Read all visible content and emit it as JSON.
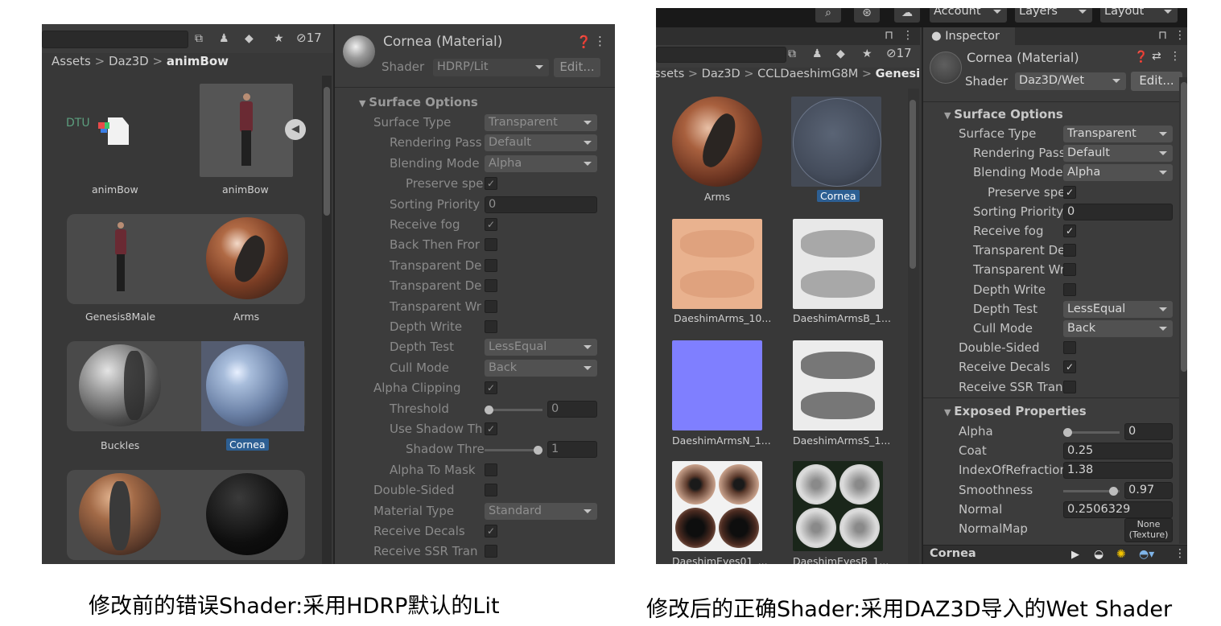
{
  "left": {
    "toolbar": {
      "hidden_count": "17"
    },
    "breadcrumb": {
      "a": "Assets",
      "b": "Daz3D",
      "c": "animBow",
      "sep": ">"
    },
    "assets": [
      {
        "label": "animBow",
        "type": "dtu",
        "badge": "DTU"
      },
      {
        "label": "animBow",
        "type": "figure"
      },
      {
        "label": "Genesis8Male",
        "type": "figure"
      },
      {
        "label": "Arms",
        "type": "sphere"
      },
      {
        "label": "Buckles",
        "type": "sphere"
      },
      {
        "label": "Cornea",
        "type": "sphere",
        "selected": true
      }
    ],
    "inspector": {
      "title": "Cornea (Material)",
      "shader_label": "Shader",
      "shader_value": "HDRP/Lit",
      "edit_label": "Edit...",
      "section": "Surface Options",
      "rows": [
        {
          "label": "Surface Type",
          "kind": "dropdown",
          "value": "Transparent"
        },
        {
          "label": "Rendering Pass",
          "kind": "dropdown",
          "value": "Default"
        },
        {
          "label": "Blending Mode",
          "kind": "dropdown",
          "value": "Alpha"
        },
        {
          "label": "Preserve spe",
          "kind": "check",
          "value": "✓"
        },
        {
          "label": "Sorting Priority",
          "kind": "field",
          "value": "0"
        },
        {
          "label": "Receive fog",
          "kind": "check",
          "value": "✓"
        },
        {
          "label": "Back Then Fror",
          "kind": "check",
          "value": ""
        },
        {
          "label": "Transparent De",
          "kind": "check",
          "value": ""
        },
        {
          "label": "Transparent De",
          "kind": "check",
          "value": ""
        },
        {
          "label": "Transparent Wr",
          "kind": "check",
          "value": ""
        },
        {
          "label": "Depth Write",
          "kind": "check",
          "value": ""
        },
        {
          "label": "Depth Test",
          "kind": "dropdown",
          "value": "LessEqual"
        },
        {
          "label": "Cull Mode",
          "kind": "dropdown",
          "value": "Back"
        },
        {
          "label": "Alpha Clipping",
          "kind": "check",
          "value": "✓"
        },
        {
          "label": "Threshold",
          "kind": "slider",
          "value": "0",
          "level": 0.0
        },
        {
          "label": "Use Shadow Th",
          "kind": "check",
          "value": "✓"
        },
        {
          "label": "Shadow Thre",
          "kind": "slider",
          "value": "1",
          "level": 1.0
        },
        {
          "label": "Alpha To Mask",
          "kind": "check",
          "value": ""
        },
        {
          "label": "Double-Sided",
          "kind": "check",
          "value": ""
        },
        {
          "label": "Material Type",
          "kind": "dropdown",
          "value": "Standard"
        },
        {
          "label": "Receive Decals",
          "kind": "check",
          "value": "✓"
        },
        {
          "label": "Receive SSR Tran",
          "kind": "check",
          "value": ""
        }
      ]
    }
  },
  "right": {
    "topbar": {
      "account": "Account",
      "layers": "Layers",
      "layout": "Layout"
    },
    "toolbar": {
      "hidden_count": "17"
    },
    "breadcrumb": {
      "a": "ssets",
      "b": "Daz3D",
      "c": "CCLDaeshimG8M",
      "d": "Genesi",
      "sep": ">"
    },
    "assets": [
      {
        "label": "Arms"
      },
      {
        "label": "Cornea",
        "selected": true
      },
      {
        "label": "DaeshimArms_10..."
      },
      {
        "label": "DaeshimArmsB_1..."
      },
      {
        "label": "DaeshimArmsN_1..."
      },
      {
        "label": "DaeshimArmsS_1..."
      },
      {
        "label": "DaeshimEyes01_..."
      },
      {
        "label": "DaeshimEyesB_1..."
      }
    ],
    "inspector": {
      "tab": "Inspector",
      "title": "Cornea (Material)",
      "shader_label": "Shader",
      "shader_value": "Daz3D/Wet",
      "edit_label": "Edit...",
      "section1": "Surface Options",
      "rows": [
        {
          "label": "Surface Type",
          "kind": "dropdown",
          "value": "Transparent",
          "indent": 0
        },
        {
          "label": "Rendering Pass",
          "kind": "dropdown",
          "value": "Default",
          "indent": 1
        },
        {
          "label": "Blending Mode",
          "kind": "dropdown",
          "value": "Alpha",
          "indent": 1
        },
        {
          "label": "Preserve spe",
          "kind": "check",
          "value": "✓",
          "indent": 2
        },
        {
          "label": "Sorting Priority",
          "kind": "field",
          "value": "0",
          "indent": 1
        },
        {
          "label": "Receive fog",
          "kind": "check",
          "value": "✓",
          "indent": 1
        },
        {
          "label": "Transparent De",
          "kind": "check",
          "value": "",
          "indent": 1
        },
        {
          "label": "Transparent Wr",
          "kind": "check",
          "value": "",
          "indent": 1
        },
        {
          "label": "Depth Write",
          "kind": "check",
          "value": "",
          "indent": 1
        },
        {
          "label": "Depth Test",
          "kind": "dropdown",
          "value": "LessEqual",
          "indent": 1
        },
        {
          "label": "Cull Mode",
          "kind": "dropdown",
          "value": "Back",
          "indent": 1
        },
        {
          "label": "Double-Sided",
          "kind": "check",
          "value": "",
          "indent": 0
        },
        {
          "label": "Receive Decals",
          "kind": "check",
          "value": "✓",
          "indent": 0
        },
        {
          "label": "Receive SSR Tran",
          "kind": "check",
          "value": "",
          "indent": 0
        }
      ],
      "section2": "Exposed Properties",
      "props": [
        {
          "label": "Alpha",
          "kind": "slider",
          "value": "0",
          "level": 0.0
        },
        {
          "label": "Coat",
          "kind": "field",
          "value": "0.25"
        },
        {
          "label": "IndexOfRefraction",
          "kind": "field",
          "value": "1.38"
        },
        {
          "label": "Smoothness",
          "kind": "slider",
          "value": "0.97",
          "level": 0.97
        },
        {
          "label": "Normal",
          "kind": "field",
          "value": "0.2506329"
        },
        {
          "label": "NormalMap",
          "kind": "texture",
          "value": "None\n(Texture)"
        }
      ],
      "footer": "Cornea"
    }
  },
  "captions": {
    "left": "修改前的错误Shader:采用HDRP默认的Lit",
    "right": "修改后的正确Shader:采用DAZ3D导入的Wet Shader"
  }
}
